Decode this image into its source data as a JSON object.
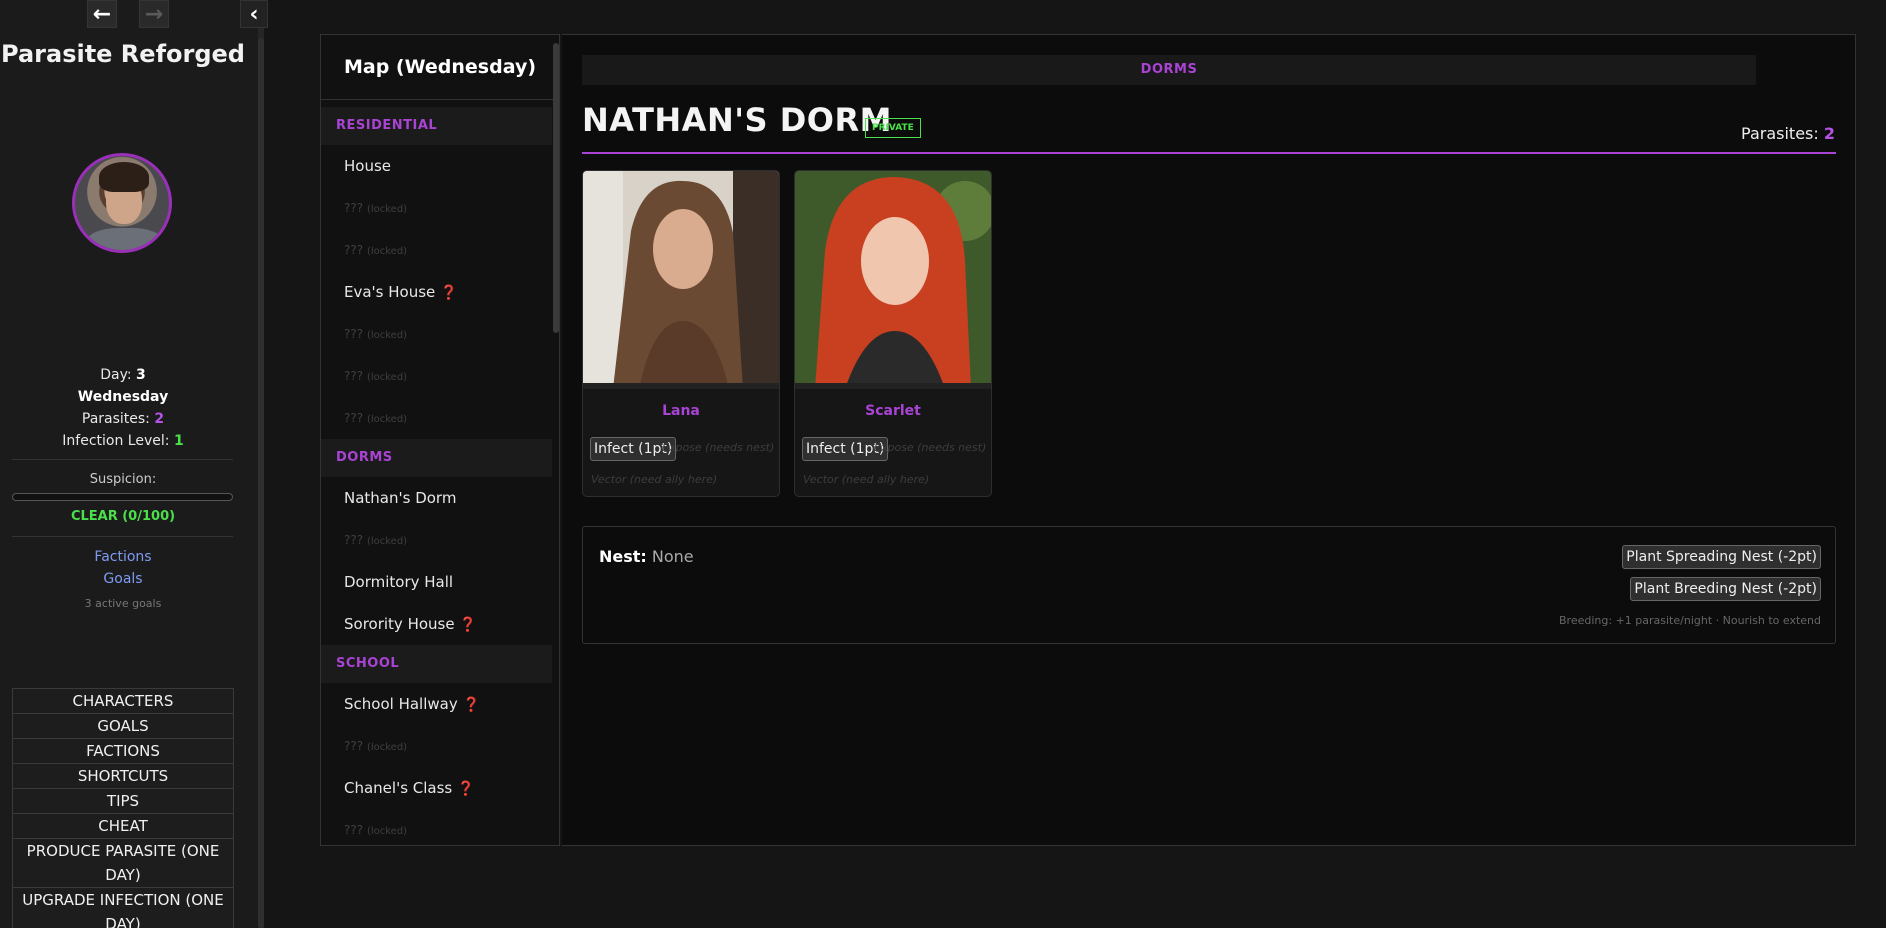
{
  "nav": {
    "back_icon": "arrow-left-icon",
    "forward_icon": "arrow-right-icon",
    "collapse_icon": "chevron-left-icon"
  },
  "sidebar": {
    "title": "Parasite Reforged",
    "day_label": "Day:",
    "day_value": "3",
    "weekday": "Wednesday",
    "parasites_label": "Parasites:",
    "parasites_value": "2",
    "infection_label": "Infection Level:",
    "infection_value": "1",
    "suspicion_label": "Suspicion:",
    "suspicion_fraction": 0,
    "suspicion_status": "CLEAR (0/100)",
    "links": {
      "factions": "Factions",
      "goals": "Goals"
    },
    "goals_count": "3 active goals",
    "menu": [
      "CHARACTERS",
      "GOALS",
      "FACTIONS",
      "SHORTCUTS",
      "TIPS",
      "CHEAT",
      "PRODUCE PARASITE (ONE DAY)",
      "UPGRADE INFECTION (ONE DAY)"
    ]
  },
  "map": {
    "title": "Map (Wednesday)",
    "sections": [
      {
        "name": "RESIDENTIAL",
        "locations": [
          {
            "label": "House",
            "locked": false,
            "quest": false
          },
          {
            "label": "???",
            "note": "(locked)",
            "locked": true
          },
          {
            "label": "???",
            "note": "(locked)",
            "locked": true
          },
          {
            "label": "Eva's House",
            "locked": false,
            "quest": true
          },
          {
            "label": "???",
            "note": "(locked)",
            "locked": true
          },
          {
            "label": "???",
            "note": "(locked)",
            "locked": true
          },
          {
            "label": "???",
            "note": "(locked)",
            "locked": true
          }
        ]
      },
      {
        "name": "DORMS",
        "locations": [
          {
            "label": "Nathan's Dorm",
            "locked": false,
            "quest": false
          },
          {
            "label": "???",
            "note": "(locked)",
            "locked": true
          },
          {
            "label": "Dormitory Hall",
            "locked": false,
            "quest": false
          },
          {
            "label": "Sorority House",
            "locked": false,
            "quest": true
          }
        ]
      },
      {
        "name": "SCHOOL",
        "locations": [
          {
            "label": "School Hallway",
            "locked": false,
            "quest": true
          },
          {
            "label": "???",
            "note": "(locked)",
            "locked": true
          },
          {
            "label": "Chanel's Class",
            "locked": false,
            "quest": true
          },
          {
            "label": "???",
            "note": "(locked)",
            "locked": true
          }
        ]
      }
    ],
    "quest_glyph": "❓"
  },
  "location": {
    "region": "DORMS",
    "name": "NATHAN'S DORM",
    "badge": "PRIVATE",
    "parasites_label": "Parasites:",
    "parasites_value": "2",
    "characters": [
      {
        "name": "Lana",
        "infect": "Infect (1pt)",
        "expose": "Expose (needs nest)",
        "vector": "Vector (need ally here)"
      },
      {
        "name": "Scarlet",
        "infect": "Infect (1pt)",
        "expose": "Expose (needs nest)",
        "vector": "Vector (need ally here)"
      }
    ],
    "nest": {
      "label": "Nest:",
      "value": "None",
      "spreading_btn": "Plant Spreading Nest (-2pt)",
      "breeding_btn": "Plant Breeding Nest (-2pt)",
      "hint": "Breeding: +1 parasite/night · Nourish to extend"
    }
  },
  "colors": {
    "accent": "#a943d4",
    "status_green": "#4be04b",
    "link": "#7f9bf0",
    "quest": "#e33"
  }
}
